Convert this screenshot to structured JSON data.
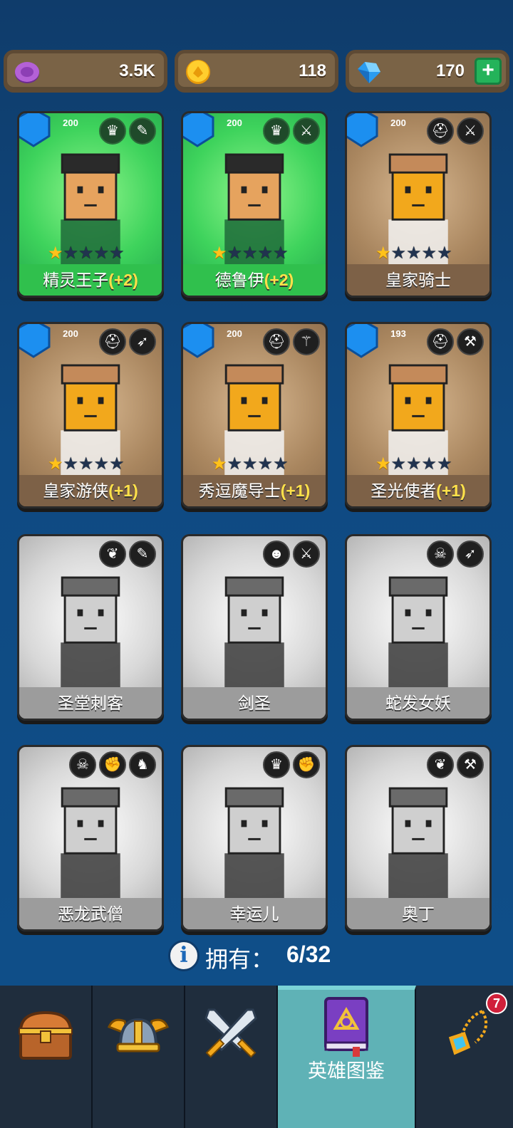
{
  "currency": {
    "essence": {
      "value": "3.5K",
      "icon": "purple-disc-icon"
    },
    "gold": {
      "value": "118",
      "icon": "gold-coin-icon"
    },
    "gems": {
      "value": "170",
      "icon": "blue-gem-icon",
      "plus": "+"
    }
  },
  "heroes": [
    {
      "name": "精灵王子",
      "bonus": "(+2)",
      "level": "200",
      "stars": 1,
      "state": "green",
      "icons": [
        "elf-class-icon",
        "dagger-icon"
      ]
    },
    {
      "name": "德鲁伊",
      "bonus": "(+2)",
      "level": "200",
      "stars": 1,
      "state": "green",
      "icons": [
        "elf-class-icon",
        "sword-icon"
      ]
    },
    {
      "name": "皇家骑士",
      "bonus": "",
      "level": "200",
      "stars": 1,
      "state": "brown",
      "icons": [
        "helmet-class-icon",
        "sword-icon"
      ]
    },
    {
      "name": "皇家游侠",
      "bonus": "(+1)",
      "level": "200",
      "stars": 1,
      "state": "brown",
      "icons": [
        "helmet-class-icon",
        "bow-icon"
      ]
    },
    {
      "name": "秀逗魔导士",
      "bonus": "(+1)",
      "level": "200",
      "stars": 1,
      "state": "brown",
      "icons": [
        "helmet-class-icon",
        "staff-icon"
      ]
    },
    {
      "name": "圣光使者",
      "bonus": "(+1)",
      "level": "193",
      "stars": 1,
      "state": "brown",
      "icons": [
        "helmet-class-icon",
        "hammer-icon"
      ]
    },
    {
      "name": "圣堂刺客",
      "bonus": "",
      "level": "",
      "stars": 0,
      "state": "gray",
      "icons": [
        "winged-emblem-icon",
        "dagger-icon"
      ]
    },
    {
      "name": "剑圣",
      "bonus": "",
      "level": "",
      "stars": 0,
      "state": "gray",
      "icons": [
        "orc-class-icon",
        "sword-icon"
      ]
    },
    {
      "name": "蛇发女妖",
      "bonus": "",
      "level": "",
      "stars": 0,
      "state": "gray",
      "icons": [
        "horned-skull-icon",
        "bow-icon"
      ]
    },
    {
      "name": "恶龙武僧",
      "bonus": "",
      "level": "",
      "stars": 0,
      "state": "gray",
      "icons": [
        "demon-skull-icon",
        "fist-icon",
        "dragon-icon"
      ]
    },
    {
      "name": "幸运儿",
      "bonus": "",
      "level": "",
      "stars": 0,
      "state": "gray",
      "icons": [
        "elf-class-icon",
        "fist-icon"
      ]
    },
    {
      "name": "奥丁",
      "bonus": "",
      "level": "",
      "stars": 0,
      "state": "gray",
      "icons": [
        "winged-emblem-icon",
        "hammer-icon"
      ]
    }
  ],
  "owned": {
    "label": "拥有：",
    "count": "6/32"
  },
  "nav": {
    "items": [
      {
        "name": "chest",
        "icon": "treasure-chest-icon",
        "label": ""
      },
      {
        "name": "helmet",
        "icon": "viking-helmet-icon",
        "label": ""
      },
      {
        "name": "battle",
        "icon": "crossed-swords-icon",
        "label": ""
      },
      {
        "name": "codex",
        "icon": "spellbook-icon",
        "label": "英雄图鉴"
      },
      {
        "name": "amulet",
        "icon": "amulet-icon",
        "label": "",
        "badge": "7"
      }
    ]
  },
  "colors": {
    "background": "#0f4a82",
    "accent": "#5fb2b6",
    "star": "#ffc21a",
    "bonus": "#ffe14a"
  }
}
